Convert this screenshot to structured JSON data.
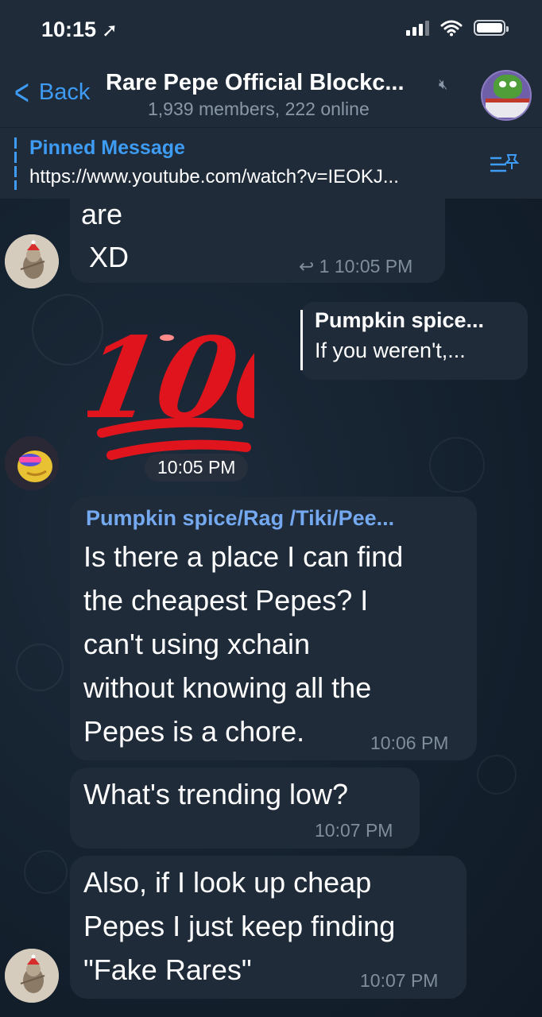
{
  "status_bar": {
    "time": "10:15",
    "location_icon": "location-arrow-icon"
  },
  "header": {
    "back_label": "Back",
    "title": "Rare Pepe Official Blockc...",
    "subtitle": "1,939 members, 222 online",
    "mute_icon": "muted-icon"
  },
  "pinned": {
    "title": "Pinned Message",
    "text": "https://www.youtube.com/watch?v=IEOKJ..."
  },
  "messages": [
    {
      "text_line1": "are",
      "text_line2": " XD",
      "reply_count": "1",
      "time": "10:05 PM"
    },
    {
      "sticker": "100",
      "time": "10:05 PM",
      "reply_name": "Pumpkin spice...",
      "reply_text": "If you weren't,..."
    },
    {
      "sender": "Pumpkin spice/Rag /Tiki/Pee...",
      "lines": [
        "Is there a place I can find",
        "the cheapest Pepes? I",
        "can't using xchain",
        "without knowing all the",
        "Pepes is a chore."
      ],
      "time": "10:06 PM"
    },
    {
      "text": "What's trending low?",
      "time": "10:07 PM"
    },
    {
      "lines": [
        "Also, if I look up cheap",
        "Pepes I just keep finding",
        "\"Fake Rares\""
      ],
      "time": "10:07 PM"
    }
  ],
  "colors": {
    "accent": "#3e9cf5",
    "bubble": "#1f2b39",
    "sender": "#74a9f0",
    "sticker_red": "#e0141c"
  }
}
